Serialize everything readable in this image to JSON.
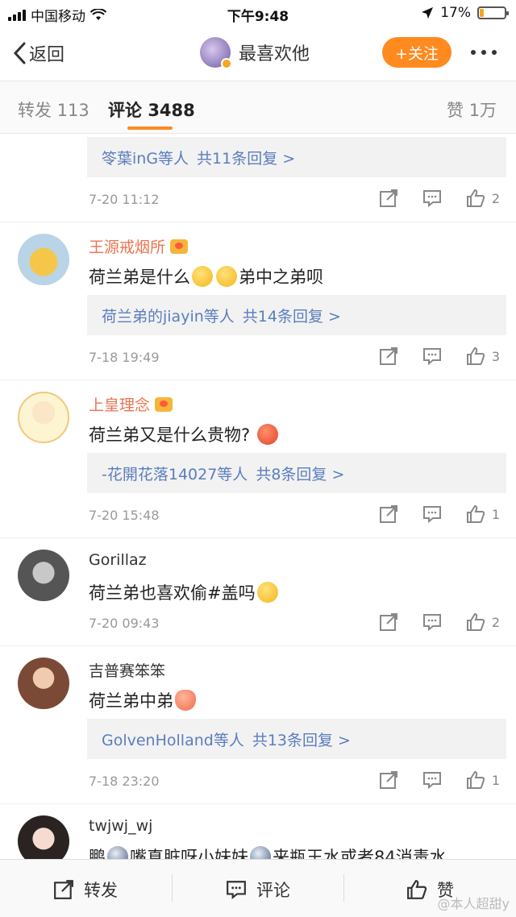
{
  "status_bar": {
    "carrier": "中国移动",
    "time": "下午9:48",
    "battery": "17%",
    "battery_level": 0.17
  },
  "nav": {
    "back_label": "返回",
    "title": "最喜欢他",
    "follow_label": "+关注"
  },
  "tabs": [
    {
      "label": "转发",
      "count": "113"
    },
    {
      "label": "评论",
      "count": "3488"
    },
    {
      "label": "赞",
      "count": "1万"
    }
  ],
  "comments": [
    {
      "username": "",
      "text": "",
      "reply_summary": "笭葉inG等人",
      "reply_count": "共11条回复 >",
      "time": "7-20 11:12",
      "likes": "2"
    },
    {
      "username": "王源戒烟所",
      "text_a": "荷兰弟是什么",
      "text_b": "弟中之弟呗",
      "reply_summary": "荷兰弟的jiayin等人",
      "reply_count": "共14条回复 >",
      "time": "7-18 19:49",
      "likes": "3"
    },
    {
      "username": "上皇理念",
      "text_a": "荷兰弟又是什么贵物?",
      "reply_summary": "-花開花落14027等人",
      "reply_count": "共8条回复 >",
      "time": "7-20 15:48",
      "likes": "1"
    },
    {
      "username": "Gorillaz",
      "text_a": "荷兰弟也喜欢偷#盖吗",
      "time": "7-20 09:43",
      "likes": "2"
    },
    {
      "username": "吉普赛笨笨",
      "text_a": "荷兰弟中弟",
      "reply_summary": "GolvenHolland等人",
      "reply_count": "共13条回复 >",
      "time": "7-18 23:20",
      "likes": "1"
    },
    {
      "username": "twjwj_wj",
      "text_a": "鹏",
      "text_b": "嘴真脏呀小妹妹",
      "text_c": "来瓶王水或者84消毒水"
    }
  ],
  "bottom_bar": {
    "repost": "转发",
    "comment": "评论",
    "like": "赞"
  },
  "watermark": "@本人超甜y",
  "colors": {
    "accent": "#ff8a1f",
    "link": "#5a7ebd",
    "vip_name": "#eb7350"
  }
}
